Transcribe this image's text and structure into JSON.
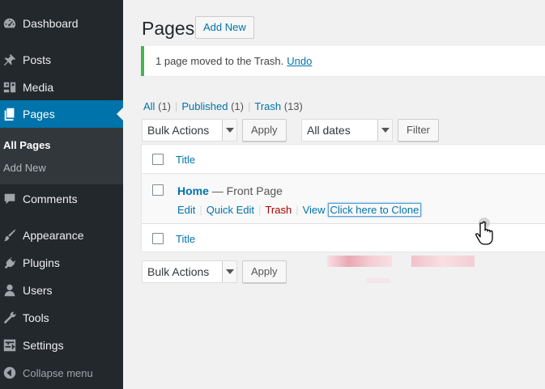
{
  "sidebar": {
    "items": [
      {
        "label": "Dashboard",
        "icon": "dashboard-icon"
      },
      {
        "label": "Posts",
        "icon": "pushpin-icon"
      },
      {
        "label": "Media",
        "icon": "media-icon"
      },
      {
        "label": "Pages",
        "icon": "pages-icon"
      },
      {
        "label": "Comments",
        "icon": "comment-icon"
      },
      {
        "label": "Appearance",
        "icon": "paintbrush-icon"
      },
      {
        "label": "Plugins",
        "icon": "plugin-icon"
      },
      {
        "label": "Users",
        "icon": "user-icon"
      },
      {
        "label": "Tools",
        "icon": "wrench-icon"
      },
      {
        "label": "Settings",
        "icon": "settings-icon"
      }
    ],
    "submenu": [
      {
        "label": "All Pages"
      },
      {
        "label": "Add New"
      }
    ],
    "collapse_label": "Collapse menu"
  },
  "header": {
    "title": "Pages",
    "add_new_label": "Add New"
  },
  "notice": {
    "message": "1 page moved to the Trash.",
    "undo_label": "Undo"
  },
  "filters": {
    "all_label": "All",
    "all_count": "(1)",
    "published_label": "Published",
    "published_count": "(1)",
    "trash_label": "Trash",
    "trash_count": "(13)"
  },
  "toolbar": {
    "bulk_actions": "Bulk Actions",
    "apply_label": "Apply",
    "dates": "All dates",
    "filter_label": "Filter"
  },
  "table": {
    "column_title": "Title",
    "rows": [
      {
        "title": "Home",
        "state": "— Front Page",
        "actions": {
          "edit": "Edit",
          "quick_edit": "Quick Edit",
          "trash": "Trash",
          "view": "View",
          "clone": "Click here to Clone"
        }
      }
    ]
  },
  "bottom_toolbar": {
    "bulk_actions": "Bulk Actions",
    "apply_label": "Apply"
  },
  "colors": {
    "sidebar_bg": "#23282d",
    "accent": "#0073aa",
    "success": "#46b450",
    "trash": "#a00"
  }
}
